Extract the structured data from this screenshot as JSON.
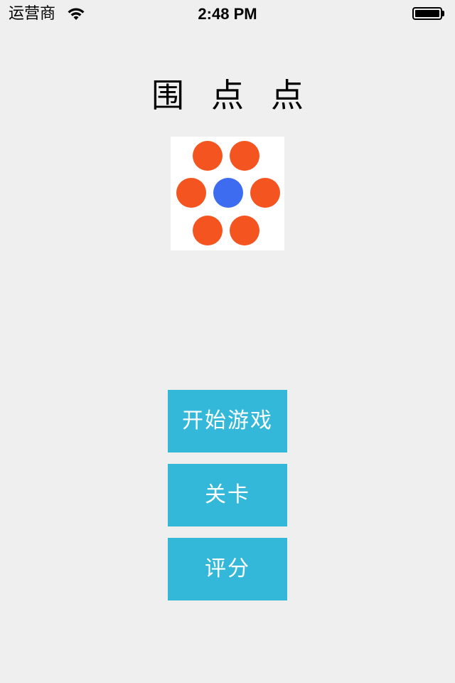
{
  "status_bar": {
    "carrier": "运营商",
    "time": "2:48 PM",
    "wifi_icon": "wifi-icon",
    "battery_icon": "battery-full-icon",
    "battery_level": 1.0
  },
  "title": "围点点",
  "logo": {
    "icon": "dots-logo-icon",
    "dot_color": "#f4541f",
    "center_color": "#3d6cf0"
  },
  "menu": {
    "start_label": "开始游戏",
    "levels_label": "关卡",
    "rate_label": "评分",
    "button_color": "#33b8da"
  }
}
